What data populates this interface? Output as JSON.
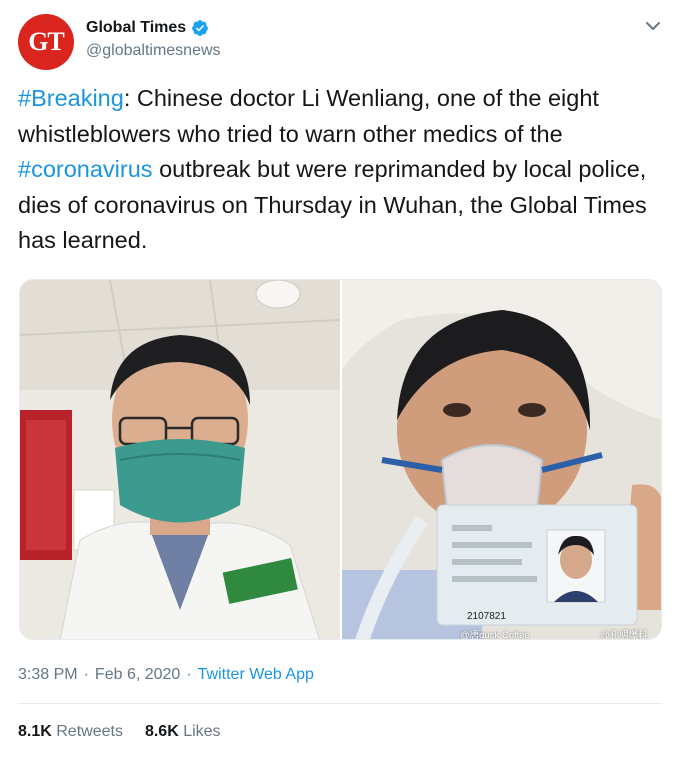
{
  "account": {
    "avatar_text": "GT",
    "display_name": "Global Times",
    "handle": "@globaltimesnews",
    "brand_color": "#d9251d",
    "verified_icon": "verified-badge-icon"
  },
  "tweet": {
    "hashtag_1": "#Breaking",
    "text_1": ": Chinese doctor Li Wenliang, one of the eight whistleblowers who tried to warn other medics of the ",
    "hashtag_2": "#coronavirus",
    "text_2": " outbreak but were reprimanded by local police, dies of coronavirus on Thursday in Wuhan, the Global Times has learned.",
    "hashtag_color": "#1b95e0"
  },
  "media": {
    "left_photo": "selfie-wearing-mask-photo",
    "right_photo": "hospital-bed-with-oxygen-mask-and-id-card-photo",
    "id_number": "2107821",
    "watermark_1": "@唐duck Coffee",
    "watermark_2": "@孔明爆料"
  },
  "meta": {
    "time": "3:38 PM",
    "date": "Feb 6, 2020",
    "source": "Twitter Web App"
  },
  "stats": {
    "retweets_count": "8.1K",
    "retweets_label": "Retweets",
    "likes_count": "8.6K",
    "likes_label": "Likes"
  }
}
